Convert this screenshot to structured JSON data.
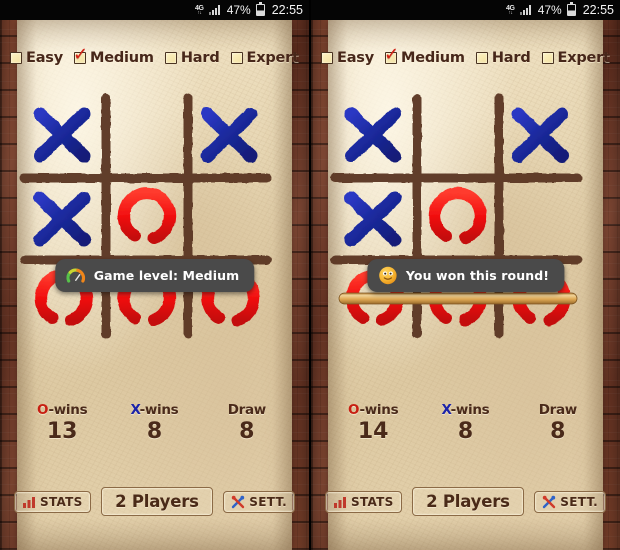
{
  "status_bar": {
    "network_big": "4G",
    "network_small": "↑↓",
    "battery_percent": "47%",
    "time": "22:55",
    "signal_icon": "signal-bars-icon",
    "battery_icon": "battery-icon"
  },
  "difficulty": {
    "options": [
      {
        "label": "Easy",
        "checked": false
      },
      {
        "label": "Medium",
        "checked": true
      },
      {
        "label": "Hard",
        "checked": false
      },
      {
        "label": "Expert",
        "checked": false
      }
    ],
    "check_glyph": "✓"
  },
  "colors": {
    "x_mark": "#1b2a9e",
    "o_mark": "#f21010",
    "grid_line": "#5a3420",
    "win_line": "#e0aa55",
    "toast_bg": "#4a4a4a",
    "parchment": "#e8d7b4",
    "wall": "#8d4630"
  },
  "panels": [
    {
      "name": "left",
      "board": {
        "cells": [
          [
            "X",
            "",
            "X"
          ],
          [
            "X",
            "O",
            ""
          ],
          [
            "O",
            "O",
            "O"
          ]
        ],
        "win_line": null
      },
      "toast": {
        "icon": "speedometer-icon",
        "text": "Game level: Medium"
      },
      "scores": [
        {
          "prefix": "O",
          "prefix_color": "o",
          "title_rest": "-wins",
          "value": "13"
        },
        {
          "prefix": "X",
          "prefix_color": "x",
          "title_rest": "-wins",
          "value": "8"
        },
        {
          "prefix": "",
          "prefix_color": "",
          "title_rest": "Draw",
          "value": "8"
        }
      ],
      "buttons": [
        {
          "label": "STATS",
          "icon": "bar-chart-icon"
        },
        {
          "label": "2 Players",
          "icon": "players-icon"
        },
        {
          "label": "SETT.",
          "icon": "tools-icon"
        }
      ]
    },
    {
      "name": "right",
      "board": {
        "cells": [
          [
            "X",
            "",
            "X"
          ],
          [
            "X",
            "O",
            ""
          ],
          [
            "O",
            "O",
            "O"
          ]
        ],
        "win_line": "row3"
      },
      "toast": {
        "icon": "smiley-icon",
        "text": "You won this round!"
      },
      "scores": [
        {
          "prefix": "O",
          "prefix_color": "o",
          "title_rest": "-wins",
          "value": "14"
        },
        {
          "prefix": "X",
          "prefix_color": "x",
          "title_rest": "-wins",
          "value": "8"
        },
        {
          "prefix": "",
          "prefix_color": "",
          "title_rest": "Draw",
          "value": "8"
        }
      ],
      "buttons": [
        {
          "label": "STATS",
          "icon": "bar-chart-icon"
        },
        {
          "label": "2 Players",
          "icon": "players-icon"
        },
        {
          "label": "SETT.",
          "icon": "tools-icon"
        }
      ]
    }
  ]
}
